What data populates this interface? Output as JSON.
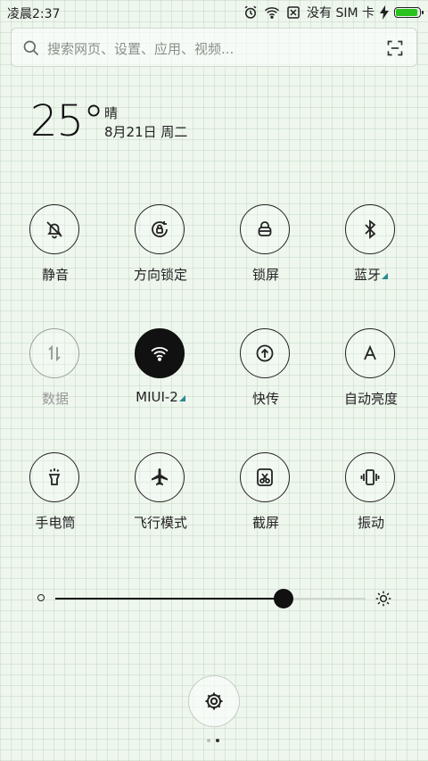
{
  "status_bar": {
    "time": "凌晨2:37",
    "sim_text": "没有 SIM 卡",
    "battery_level": 1.0,
    "icons": [
      "alarm-icon",
      "wifi-icon",
      "no-sim-icon",
      "charging-icon",
      "battery-icon"
    ]
  },
  "search": {
    "placeholder": "搜索网页、设置、应用、视频..."
  },
  "weather": {
    "temperature": "25°",
    "condition": "晴",
    "date": "8月21日 周二"
  },
  "toggles": [
    {
      "label": "静音",
      "icon": "bell-off-icon",
      "state": "off"
    },
    {
      "label": "方向锁定",
      "icon": "rotation-lock-icon",
      "state": "off"
    },
    {
      "label": "锁屏",
      "icon": "lock-icon",
      "state": "off"
    },
    {
      "label": "蓝牙",
      "icon": "bluetooth-icon",
      "state": "off",
      "has_submenu": true
    },
    {
      "label": "数据",
      "icon": "data-arrows-icon",
      "state": "disabled"
    },
    {
      "label": "MIUI-2",
      "icon": "wifi-icon",
      "state": "on",
      "has_submenu": true
    },
    {
      "label": "快传",
      "icon": "share-upload-icon",
      "state": "off"
    },
    {
      "label": "自动亮度",
      "icon": "auto-brightness-icon",
      "state": "off"
    },
    {
      "label": "手电筒",
      "icon": "flashlight-icon",
      "state": "off"
    },
    {
      "label": "飞行模式",
      "icon": "airplane-icon",
      "state": "off"
    },
    {
      "label": "截屏",
      "icon": "screenshot-icon",
      "state": "off"
    },
    {
      "label": "振动",
      "icon": "vibrate-icon",
      "state": "off"
    }
  ],
  "brightness": {
    "level": 0.737,
    "low_icon": "brightness-low-icon",
    "high_icon": "brightness-high-icon"
  },
  "settings_icon": "gear-icon",
  "page_indicator": {
    "count": 2,
    "active": 1
  },
  "colors": {
    "background": "#eef6ee",
    "active_toggle": "#111111",
    "battery": "#27c21c",
    "submenu_marker": "#2b8a8f"
  }
}
